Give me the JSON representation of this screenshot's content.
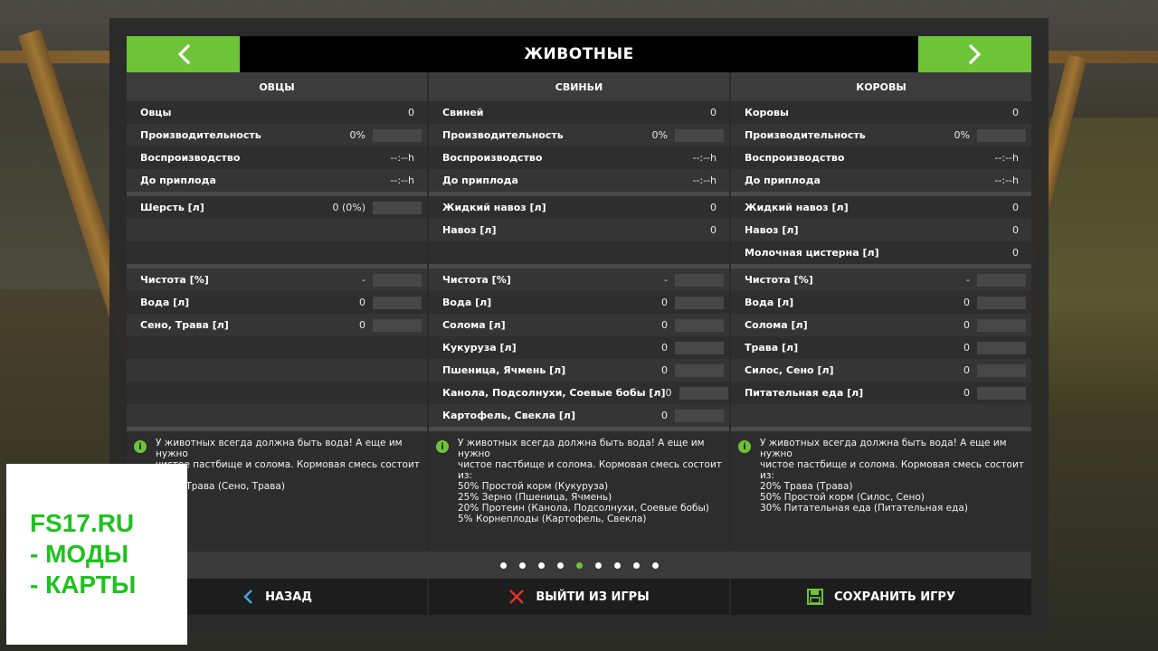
{
  "window": {
    "title": "ЖИВОТНЫЕ"
  },
  "columns": [
    {
      "header": "ОВЦЫ",
      "stats": [
        {
          "label": "Овцы",
          "value": "0",
          "bar": false
        },
        {
          "label": "Производительность",
          "value": "0%",
          "bar": true
        },
        {
          "label": "Воспроизводство",
          "value": "--:--h",
          "bar": false
        },
        {
          "label": "До приплода",
          "value": "--:--h",
          "bar": false
        }
      ],
      "products": [
        {
          "label": "Шерсть [л]",
          "value": "0 (0%)",
          "bar": true
        },
        {
          "label": "",
          "value": "",
          "bar": false
        },
        {
          "label": "",
          "value": "",
          "bar": false
        }
      ],
      "feed": [
        {
          "label": "Чистота [%]",
          "value": "-",
          "bar": true
        },
        {
          "label": "Вода [л]",
          "value": "0",
          "bar": true
        },
        {
          "label": "Сено, Трава [л]",
          "value": "0",
          "bar": true
        },
        {
          "label": "",
          "value": "",
          "bar": false
        },
        {
          "label": "",
          "value": "",
          "bar": false
        },
        {
          "label": "",
          "value": "",
          "bar": false
        },
        {
          "label": "",
          "value": "",
          "bar": false
        }
      ],
      "info": "У животных всегда должна быть вода! А еще им нужно\nчистое пастбище и солома. Кормовая смесь состоит\nиз:\n100% Трава (Сено, Трава)"
    },
    {
      "header": "СВИНЬИ",
      "stats": [
        {
          "label": "Свиней",
          "value": "0",
          "bar": false
        },
        {
          "label": "Производительность",
          "value": "0%",
          "bar": true
        },
        {
          "label": "Воспроизводство",
          "value": "--:--h",
          "bar": false
        },
        {
          "label": "До приплода",
          "value": "--:--h",
          "bar": false
        }
      ],
      "products": [
        {
          "label": "Жидкий навоз [л]",
          "value": "0",
          "bar": false
        },
        {
          "label": "Навоз [л]",
          "value": "0",
          "bar": false
        },
        {
          "label": "",
          "value": "",
          "bar": false
        }
      ],
      "feed": [
        {
          "label": "Чистота [%]",
          "value": "-",
          "bar": true
        },
        {
          "label": "Вода [л]",
          "value": "0",
          "bar": true
        },
        {
          "label": "Солома [л]",
          "value": "0",
          "bar": true
        },
        {
          "label": "Кукуруза [л]",
          "value": "0",
          "bar": true
        },
        {
          "label": "Пшеница, Ячмень [л]",
          "value": "0",
          "bar": true
        },
        {
          "label": "Канола, Подсолнухи, Соевые бобы [л]",
          "value": "0",
          "bar": true
        },
        {
          "label": "Картофель, Свекла [л]",
          "value": "0",
          "bar": true
        }
      ],
      "info": "У животных всегда должна быть вода! А еще им нужно\nчистое пастбище и солома. Кормовая смесь состоит\nиз:\n50% Простой корм (Кукуруза)\n25% Зерно (Пшеница, Ячмень)\n20% Протеин (Канола, Подсолнухи, Соевые бобы)\n5% Корнеплоды (Картофель, Свекла)"
    },
    {
      "header": "КОРОВЫ",
      "stats": [
        {
          "label": "Коровы",
          "value": "0",
          "bar": false
        },
        {
          "label": "Производительность",
          "value": "0%",
          "bar": true
        },
        {
          "label": "Воспроизводство",
          "value": "--:--h",
          "bar": false
        },
        {
          "label": "До приплода",
          "value": "--:--h",
          "bar": false
        }
      ],
      "products": [
        {
          "label": "Жидкий навоз [л]",
          "value": "0",
          "bar": false
        },
        {
          "label": "Навоз [л]",
          "value": "0",
          "bar": false
        },
        {
          "label": "Молочная цистерна [л]",
          "value": "0",
          "bar": false
        }
      ],
      "feed": [
        {
          "label": "Чистота [%]",
          "value": "-",
          "bar": true
        },
        {
          "label": "Вода [л]",
          "value": "0",
          "bar": true
        },
        {
          "label": "Солома [л]",
          "value": "0",
          "bar": true
        },
        {
          "label": "Трава [л]",
          "value": "0",
          "bar": true
        },
        {
          "label": "Силос, Сено [л]",
          "value": "0",
          "bar": true
        },
        {
          "label": "Питательная еда [л]",
          "value": "0",
          "bar": true
        },
        {
          "label": "",
          "value": "",
          "bar": false
        }
      ],
      "info": "У животных всегда должна быть вода! А еще им нужно\nчистое пастбище и солома. Кормовая смесь состоит\nиз:\n20% Трава (Трава)\n50% Простой корм (Силос, Сено)\n30% Питательная еда (Питательная еда)"
    }
  ],
  "pager": {
    "count": 9,
    "active_index": 4
  },
  "footer": {
    "back_label": "НАЗАД",
    "quit_label": "ВЫЙТИ ИЗ ИГРЫ",
    "save_label": "СОХРАНИТЬ ИГРУ"
  },
  "watermark": {
    "lines": [
      "FS17.RU",
      "- МОДЫ",
      "- КАРТЫ"
    ]
  },
  "colors": {
    "accent": "#6ec437",
    "quit": "#e0322b",
    "back": "#3fa4e0"
  }
}
